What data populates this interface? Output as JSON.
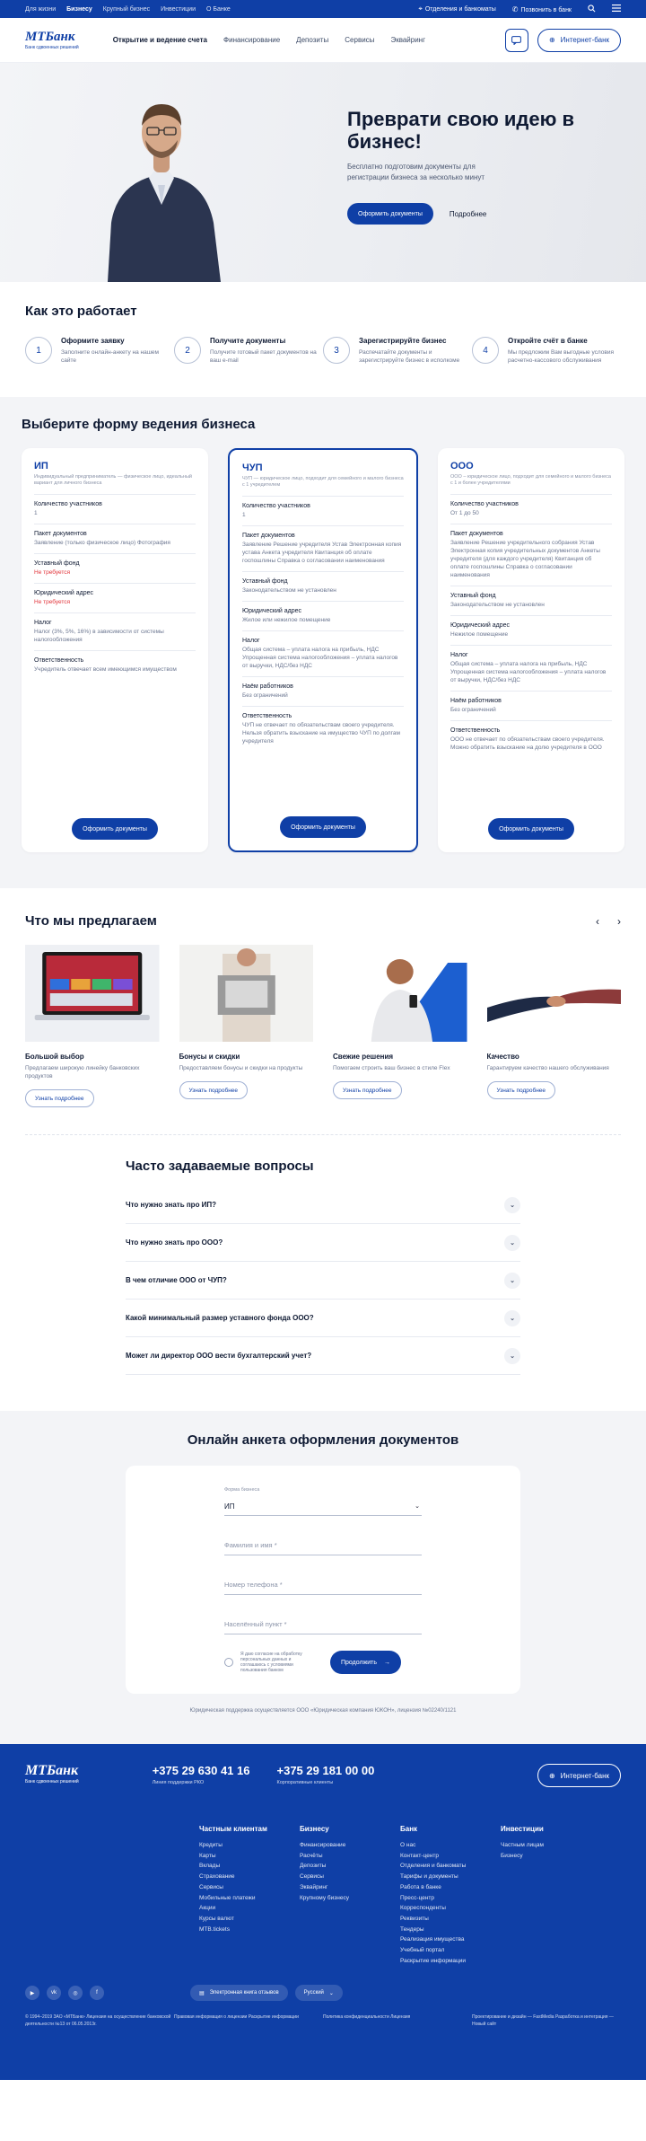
{
  "topbar": {
    "tabs": [
      "Для жизни",
      "Бизнесу",
      "Крупный бизнес",
      "Инвестиции",
      "О Банке"
    ],
    "branches": "Отделения и банкоматы",
    "call": "Позвонить в банк"
  },
  "header": {
    "logo": "МТБанк",
    "slogan": "Банк сдвоенных решений",
    "nav": [
      "Открытие и ведение счета",
      "Финансирование",
      "Депозиты",
      "Сервисы",
      "Эквайринг"
    ],
    "ib": "Интернет-банк"
  },
  "hero": {
    "title": "Преврати свою идею в бизнес!",
    "text": "Бесплатно подготовим документы для регистрации бизнеса за несколько минут",
    "primary": "Оформить документы",
    "more": "Подробнее"
  },
  "how": {
    "title": "Как это работает",
    "steps": [
      {
        "n": "1",
        "t": "Оформите заявку",
        "d": "Заполните онлайн-анкету на нашем сайте"
      },
      {
        "n": "2",
        "t": "Получите документы",
        "d": "Получите готовый пакет документов на ваш e-mail"
      },
      {
        "n": "3",
        "t": "Зарегистрируйте бизнес",
        "d": "Распечатайте документы и зарегистрируйте бизнес в исполкоме"
      },
      {
        "n": "4",
        "t": "Откройте счёт в банке",
        "d": "Мы предложим Вам выгодные условия расчетно-кассового обслуживания"
      }
    ]
  },
  "forms": {
    "title": "Выберите форму ведения бизнеса",
    "cta": "Оформить документы",
    "cards": [
      {
        "t": "ИП",
        "s": "Индивидуальный предприниматель — физическое лицо, идеальный вариант для личного бизнеса",
        "rows": [
          {
            "l": "Количество участников",
            "v": "1"
          },
          {
            "l": "Пакет документов",
            "v": "Заявление (только физическое лицо) Фотография"
          },
          {
            "l": "Уставный фонд",
            "v": "Не требуется",
            "red": true
          },
          {
            "l": "Юридический адрес",
            "v": "Не требуется",
            "red": true
          },
          {
            "l": "Налог",
            "v": "Налог (3%, 5%, 16%) в зависимости от системы налогообложения"
          },
          {
            "l": "Ответственность",
            "v": "Учредитель отвечает всем имеющимся имуществом"
          }
        ]
      },
      {
        "t": "ЧУП",
        "s": "ЧУП — юридическое лицо, подходит для семейного и малого бизнеса с 1 учредителем",
        "rows": [
          {
            "l": "Количество участников",
            "v": "1"
          },
          {
            "l": "Пакет документов",
            "v": "Заявление Решение учредителя Устав Электронная копия устава Анкета учредителя Квитанция об оплате госпошлины Справка о согласовании наименования"
          },
          {
            "l": "Уставный фонд",
            "v": "Законодательством не установлен"
          },
          {
            "l": "Юридический адрес",
            "v": "Жилое или нежилое помещение"
          },
          {
            "l": "Налог",
            "v": "Общая система – уплата налога на прибыль, НДС Упрощенная система налогообложения – уплата налогов от выручки, НДС/без НДС"
          },
          {
            "l": "Наём работников",
            "v": "Без ограничений"
          },
          {
            "l": "Ответственность",
            "v": "ЧУП не отвечает по обязательствам своего учредителя. Нельзя обратить взыскание на имущество ЧУП по долгам учредителя"
          }
        ]
      },
      {
        "t": "ООО",
        "s": "ООО – юридическое лицо, подходит для семейного и малого бизнеса с 1 и более учредителями",
        "rows": [
          {
            "l": "Количество участников",
            "v": "От 1 до 50"
          },
          {
            "l": "Пакет документов",
            "v": "Заявление Решение учредительного собрания Устав Электронная копия учредительных документов Анкеты учредителя (для каждого учредителя) Квитанция об оплате госпошлины Справка о согласовании наименования"
          },
          {
            "l": "Уставный фонд",
            "v": "Законодательством не установлен"
          },
          {
            "l": "Юридический адрес",
            "v": "Нежилое помещение"
          },
          {
            "l": "Налог",
            "v": "Общая система – уплата налога на прибыль, НДС Упрощенная система налогообложения – уплата налогов от выручки, НДС/без НДС"
          },
          {
            "l": "Наём работников",
            "v": "Без ограничений"
          },
          {
            "l": "Ответственность",
            "v": "ООО не отвечает по обязательствам своего учредителя. Можно обратить взыскание на долю учредителя в ООО"
          }
        ]
      }
    ]
  },
  "offer": {
    "title": "Что мы предлагаем",
    "cta": "Узнать подробнее",
    "items": [
      {
        "t": "Большой выбор",
        "d": "Предлагаем широкую линейку банковских продуктов"
      },
      {
        "t": "Бонусы и скидки",
        "d": "Предоставляем бонусы и скидки на продукты"
      },
      {
        "t": "Свежие решения",
        "d": "Помогаем строить ваш бизнес в стиле Flex"
      },
      {
        "t": "Качество",
        "d": "Гарантируем качество нашего обслуживания"
      }
    ]
  },
  "faq": {
    "title": "Часто задаваемые вопросы",
    "items": [
      "Что нужно знать про ИП?",
      "Что нужно знать про ООО?",
      "В чем отличие ООО от ЧУП?",
      "Какой минимальный размер уставного фонда ООО?",
      "Может ли директор ООО вести бухгалтерский учет?"
    ]
  },
  "application": {
    "title": "Онлайн анкета оформления документов",
    "type_label": "Форма бизнеса",
    "type_value": "ИП",
    "name_ph": "Фамилия и имя *",
    "phone_ph": "Номер телефона *",
    "city_ph": "Населённый пункт *",
    "agree": "Я даю согласие на обработку персональных данных и соглашаюсь с условиями пользования банком",
    "next": "Продолжить",
    "legal": "Юридическая поддержка осуществляется ООО «Юридическая компания ЮКОН», лицензия №02240/1121"
  },
  "footer": {
    "logo": "МТБанк",
    "slogan": "Банк сдвоенных решений",
    "phone1": "+375 29 630 41 16",
    "phone1_d": "Линия поддержки РКО",
    "phone2": "+375 29 181 00 00",
    "phone2_d": "Корпоративные клиенты",
    "ib": "Интернет-банк",
    "cols": [
      {
        "h": "Частным клиентам",
        "i": [
          "Кредиты",
          "Карты",
          "Вклады",
          "Страхование",
          "Сервисы",
          "Мобильные платежи",
          "Акции",
          "Курсы валют",
          "MTB.tickets"
        ]
      },
      {
        "h": "Бизнесу",
        "i": [
          "Финансирование",
          "Расчёты",
          "Депозиты",
          "Сервисы",
          "Эквайринг",
          "Крупному бизнесу"
        ]
      },
      {
        "h": "Банк",
        "i": [
          "О нас",
          "Контакт-центр",
          "Отделения и банкоматы",
          "Тарифы и документы",
          "Работа в банке",
          "Пресс-центр",
          "Корреспонденты",
          "Реквизиты",
          "Тендеры",
          "Реализация имущества",
          "Учебный портал",
          "Раскрытие информации"
        ]
      },
      {
        "h": "Инвестиции",
        "i": [
          "Частным лицам",
          "Бизнесу"
        ]
      }
    ],
    "reviews": "Электронная книга отзывов",
    "lang": "Русский",
    "bottom": [
      "© 1994–2019 ЗАО «МТБанк» Лицензия на осуществление банковской деятельности №13 от 06.05.2013г.",
      "Правовая информация о лицензии Раскрытие информации",
      "Политика конфиденциальности Лицензия",
      "Проектирование и дизайн — FastMedia Разработка и интеграция — Новый сайт"
    ]
  }
}
